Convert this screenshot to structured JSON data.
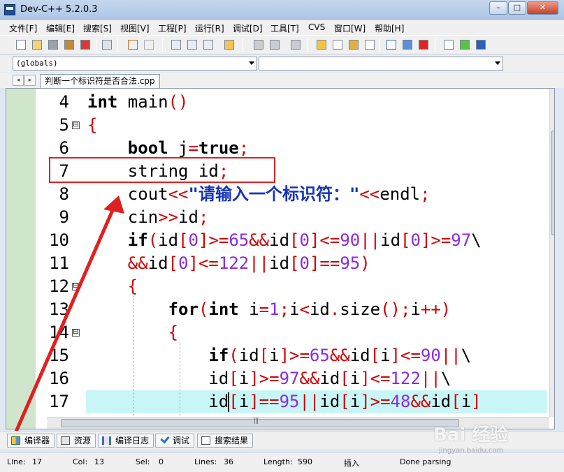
{
  "window": {
    "title": "Dev-C++ 5.2.0.3",
    "minimize": "–",
    "maximize": "□",
    "close": "✕"
  },
  "menu": [
    "文件[F]",
    "编辑[E]",
    "搜索[S]",
    "视图[V]",
    "工程[P]",
    "运行[R]",
    "调试[D]",
    "工具[T]",
    "CVS",
    "窗口[W]",
    "帮助[H]"
  ],
  "combos": {
    "scope": "(globals)",
    "function": ""
  },
  "tabs": {
    "prev": "◂",
    "next": "▸",
    "file": "判断一个标识符是否合法.cpp"
  },
  "editor": {
    "lines": [
      {
        "no": "4",
        "fold": ""
      },
      {
        "no": "5",
        "fold": "⊟"
      },
      {
        "no": "6",
        "fold": ""
      },
      {
        "no": "7",
        "fold": ""
      },
      {
        "no": "8",
        "fold": ""
      },
      {
        "no": "9",
        "fold": ""
      },
      {
        "no": "10",
        "fold": ""
      },
      {
        "no": "11",
        "fold": ""
      },
      {
        "no": "12",
        "fold": "⊟"
      },
      {
        "no": "13",
        "fold": ""
      },
      {
        "no": "14",
        "fold": "⊟"
      },
      {
        "no": "15",
        "fold": ""
      },
      {
        "no": "16",
        "fold": ""
      },
      {
        "no": "17",
        "fold": ""
      }
    ],
    "current_line_color": "#c8f6f6"
  },
  "bottom_tabs": [
    "编译器",
    "资源",
    "编译日志",
    "调试",
    "搜索结果"
  ],
  "status": {
    "line_label": "Line:",
    "line_value": "17",
    "col_label": "Col:",
    "col_value": "13",
    "sel_label": "Sel:",
    "sel_value": "0",
    "lines_label": "Lines:",
    "lines_value": "36",
    "length_label": "Length:",
    "length_value": "590",
    "mode": "插入",
    "message": "Done parsing"
  },
  "watermark": {
    "brand": "Bai 经验",
    "url": "jingyan.baidu.com"
  },
  "colors": {
    "keyword": "#000000",
    "operator": "#d00000",
    "number": "#8a2be2",
    "string": "#1533b8",
    "annotation": "#e02020"
  }
}
